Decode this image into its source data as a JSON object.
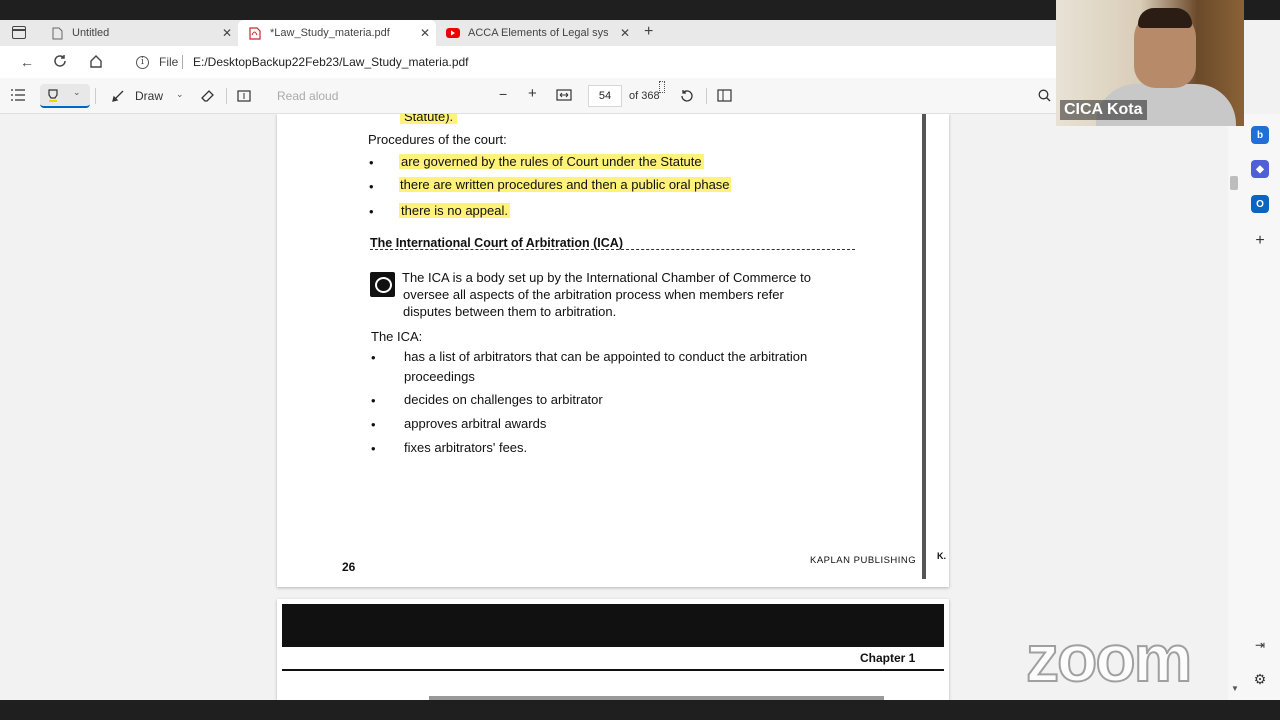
{
  "tabs": [
    {
      "title": "Untitled",
      "active": false
    },
    {
      "title": "*Law_Study_materia.pdf",
      "active": true
    },
    {
      "title": "ACCA Elements of Legal system",
      "active": false
    }
  ],
  "address": {
    "protocol_label": "File",
    "url": "E:/DesktopBackup22Feb23/Law_Study_materia.pdf"
  },
  "pdf_toolbar": {
    "draw_label": "Draw",
    "read_aloud_label": "Read aloud",
    "current_page": "54",
    "page_total": "of 368"
  },
  "page1": {
    "top_fragment": "Statute).",
    "procedures_heading": "Procedures of the court:",
    "procedures": [
      "are governed by the rules of Court under the Statute",
      "there are written procedures and then a public oral phase",
      "there is no appeal."
    ],
    "ica_heading": "The International Court of Arbitration (ICA)",
    "ica_definition": [
      "The ICA is a body set up by the International Chamber of Commerce to",
      "oversee all aspects of the arbitration process when members refer",
      "disputes between them to arbitration."
    ],
    "ica_list_heading": "The ICA:",
    "ica_items": [
      [
        "has a list of arbitrators that can be appointed to conduct the arbitration",
        "proceedings"
      ],
      [
        "decides on challenges to arbitrator"
      ],
      [
        "approves arbitral awards"
      ],
      [
        "fixes arbitrators' fees."
      ]
    ],
    "page_number": "26",
    "publisher": "KAPLAN PUBLISHING",
    "edge_mark": "K."
  },
  "page2": {
    "chapter": "Chapter 1"
  },
  "webcam": {
    "participant_name": "CICA Kota"
  },
  "overlay": {
    "watermark": "zoom"
  },
  "sidebar": {
    "icons": [
      "bing-icon",
      "copilot-icon",
      "outlook-icon",
      "add-icon"
    ]
  }
}
